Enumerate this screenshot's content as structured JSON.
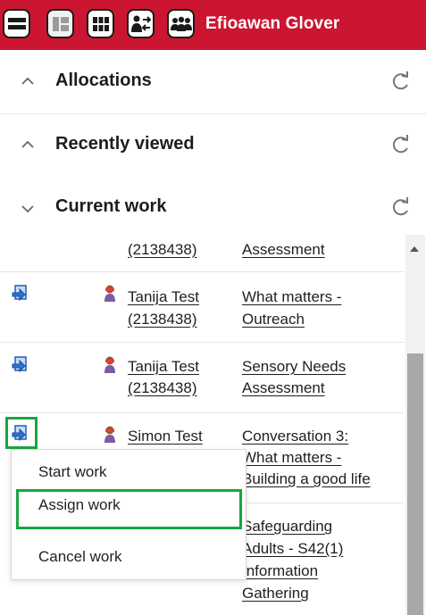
{
  "header": {
    "user_name": "Efioawan Glover",
    "buttons": [
      {
        "icon": "full-view-icon"
      },
      {
        "icon": "split-layout-icon"
      },
      {
        "icon": "grid-view-icon"
      },
      {
        "icon": "transfer-icon"
      },
      {
        "icon": "team-icon"
      }
    ],
    "colors": {
      "bar": "#cc1531",
      "text": "#ffffff"
    }
  },
  "sections": [
    {
      "title": "Allocations",
      "expanded": false
    },
    {
      "title": "Recently viewed",
      "expanded": false
    },
    {
      "title": "Current work",
      "expanded": true
    }
  ],
  "current_work": {
    "rows": [
      {
        "person_line1": "",
        "person_line2": "(2138438)",
        "work_line1": "Assessment",
        "work_line2": "",
        "work_line3": ""
      },
      {
        "person_line1": "Tanija Test",
        "person_line2": "(2138438)",
        "work_line1": "What matters -",
        "work_line2": "Outreach",
        "work_line3": ""
      },
      {
        "person_line1": "Tanija Test",
        "person_line2": "(2138438)",
        "work_line1": "Sensory Needs",
        "work_line2": "Assessment",
        "work_line3": ""
      },
      {
        "person_line1": "Simon Test",
        "person_line2": "",
        "work_line1": "Conversation 3:",
        "work_line2": "What matters -",
        "work_line3": "Building a good life"
      },
      {
        "person_line1": "",
        "person_line2": "",
        "work_line1": "Safeguarding",
        "work_line2": "Adults - S42(1)",
        "work_line3": "Information",
        "work_line4": "Gathering"
      }
    ]
  },
  "context_menu": {
    "items": [
      "Start work",
      "Assign work",
      "Cancel work"
    ],
    "highlighted": "Assign work"
  },
  "highlight_color": "#1aa442"
}
